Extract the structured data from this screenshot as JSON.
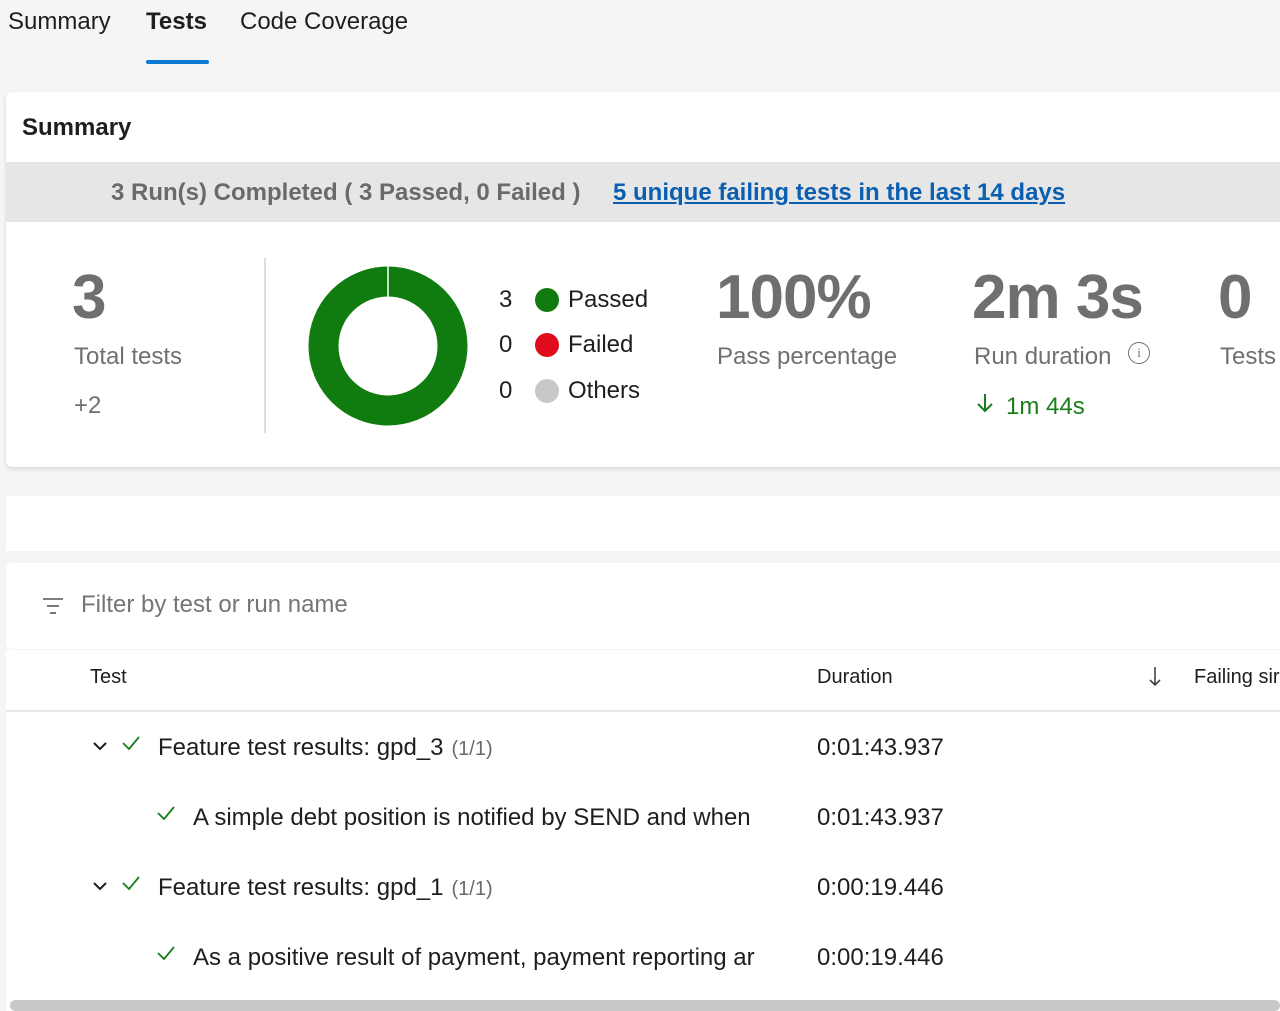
{
  "tabs": [
    {
      "label": "Summary"
    },
    {
      "label": "Tests"
    },
    {
      "label": "Code Coverage"
    }
  ],
  "summary": {
    "title": "Summary",
    "banner_text": "3 Run(s) Completed ( 3 Passed, 0 Failed )",
    "banner_link": "5 unique failing tests in the last 14 days",
    "total_tests": {
      "value": "3",
      "label": "Total tests",
      "delta": "+2"
    },
    "chart_data": {
      "type": "pie",
      "donut": true,
      "categories": [
        "Passed",
        "Failed",
        "Others"
      ],
      "values": [
        3,
        0,
        0
      ],
      "colors": [
        "#107c10",
        "#e00b1c",
        "#c8c8c8"
      ]
    },
    "legend": [
      {
        "count": "3",
        "label": "Passed",
        "color": "#107c10"
      },
      {
        "count": "0",
        "label": "Failed",
        "color": "#e00b1c"
      },
      {
        "count": "0",
        "label": "Others",
        "color": "#c8c8c8"
      }
    ],
    "pass_percentage": {
      "value": "100%",
      "label": "Pass percentage"
    },
    "run_duration": {
      "value": "2m 3s",
      "label": "Run duration",
      "delta": "1m 44s",
      "delta_color": "#1a7d1a"
    },
    "tests_extra": {
      "value": "0",
      "label": "Tests"
    }
  },
  "filter": {
    "placeholder": "Filter by test or run name",
    "icon": "filter-icon"
  },
  "table": {
    "headers": {
      "test": "Test",
      "duration": "Duration",
      "failing_since": "Failing sir"
    },
    "rows": [
      {
        "level": 0,
        "name": "Feature test results: gpd_3",
        "count": "(1/1)",
        "duration": "0:01:43.937"
      },
      {
        "level": 1,
        "name": "A simple debt position is notified by SEND and when",
        "count": "",
        "duration": "0:01:43.937"
      },
      {
        "level": 0,
        "name": "Feature test results: gpd_1",
        "count": "(1/1)",
        "duration": "0:00:19.446"
      },
      {
        "level": 1,
        "name": "As a positive result of payment, payment reporting ar",
        "count": "",
        "duration": "0:00:19.446"
      }
    ]
  }
}
